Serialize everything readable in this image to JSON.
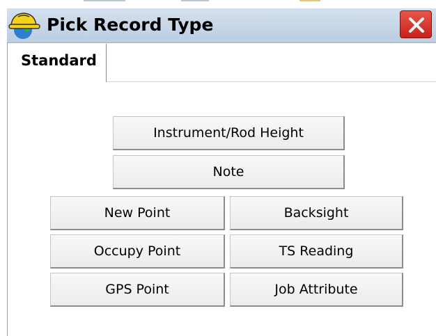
{
  "window": {
    "title": "Pick Record Type",
    "icon": "app-hardhat-icon",
    "close_icon": "close-icon"
  },
  "tabs": [
    {
      "label": "Standard",
      "active": true
    }
  ],
  "buttons": {
    "instrument_rod_height": "Instrument/Rod Height",
    "note": "Note",
    "new_point": "New Point",
    "backsight": "Backsight",
    "occupy_point": "Occupy Point",
    "ts_reading": "TS Reading",
    "gps_point": "GPS Point",
    "job_attribute": "Job Attribute"
  },
  "colors": {
    "titlebar": "#c8d6e8",
    "close": "#d9342b"
  }
}
